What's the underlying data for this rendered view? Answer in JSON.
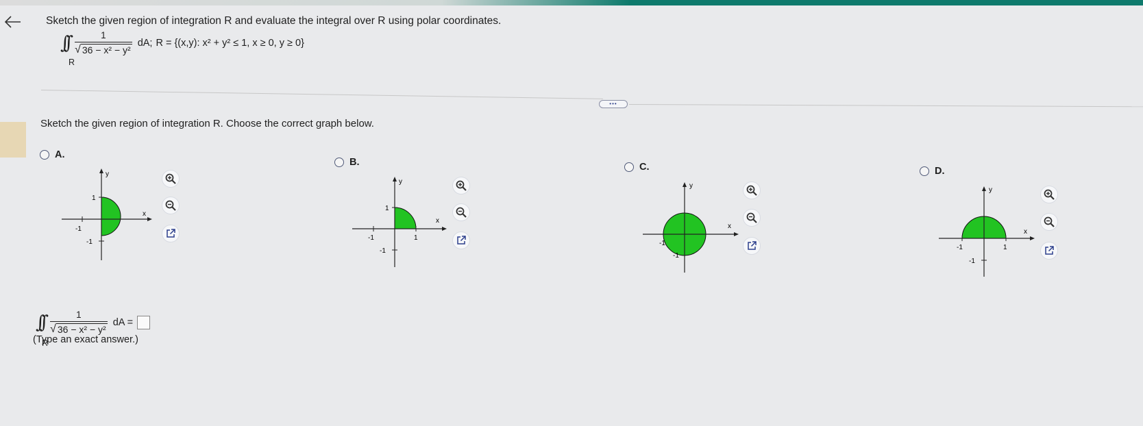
{
  "question": {
    "prompt": "Sketch the given region of integration R and evaluate the integral over R using polar coordinates.",
    "integral": {
      "sub": "R",
      "numerator": "1",
      "radicand": "36 − x² − y²",
      "differential": "dA;",
      "region": "R = {(x,y): x² + y² ≤ 1, x ≥ 0, y ≥ 0}"
    }
  },
  "part1": {
    "instruction": "Sketch the given region of integration R. Choose the correct graph below.",
    "options": [
      {
        "letter": "A.",
        "selected": false,
        "x_label": "x",
        "y_label": "y",
        "tick_neg_x": "-1",
        "tick_pos_y": "1",
        "tick_neg_y": "-1"
      },
      {
        "letter": "B.",
        "selected": false,
        "x_label": "x",
        "y_label": "y",
        "tick_neg_x": "-1",
        "tick_pos_x": "1",
        "tick_pos_y": "1",
        "tick_neg_y": "-1"
      },
      {
        "letter": "C.",
        "selected": false,
        "x_label": "x",
        "y_label": "y",
        "tick_neg_x": "-1",
        "tick_neg_y": "-1"
      },
      {
        "letter": "D.",
        "selected": false,
        "x_label": "x",
        "y_label": "y",
        "tick_neg_x": "-1",
        "tick_pos_x": "1",
        "tick_neg_y": "-1"
      }
    ],
    "tools": [
      "zoom-in-icon",
      "zoom-out-icon",
      "pop-out-icon"
    ]
  },
  "part2": {
    "sub": "R",
    "numerator": "1",
    "radicand": "36 − x² − y²",
    "lhs_tail": "dA =",
    "answer_value": "",
    "hint": "(Type an exact answer.)"
  },
  "more_button": "•••",
  "colors": {
    "fill": "#22c322",
    "accent": "#0e7a6c"
  }
}
